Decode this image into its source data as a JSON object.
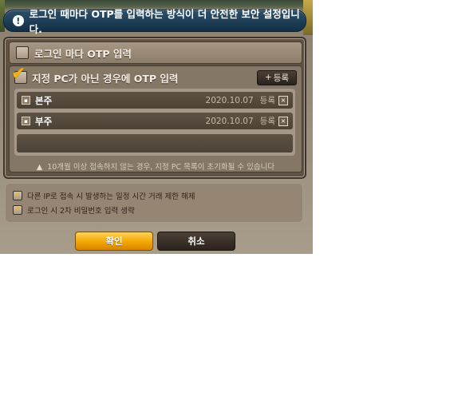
{
  "header": {
    "message": "로그인 때마다 OTP를 입력하는 방식이 더 안전한 보안 설정입니다.",
    "icon": "info-icon"
  },
  "options": {
    "every_login": {
      "label": "로그인 마다 OTP 입력",
      "checked": false
    },
    "non_designated": {
      "label": "지정 PC가 아닌 경우에 OTP 입력",
      "checked": true,
      "register_label": "등록"
    }
  },
  "pc_list": [
    {
      "name": "본주",
      "date": "2020.10.07",
      "status": "등록"
    },
    {
      "name": "부주",
      "date": "2020.10.07",
      "status": "등록"
    }
  ],
  "notice": "10개월 이상 접속하지 않는 경우, 지정 PC 목록이 초기화될 수 있습니다",
  "extra_options": [
    {
      "label": "다른 IP로 접속 시 발생하는 일정 시간 거래 제한 해제",
      "checked": true
    },
    {
      "label": "로그인 시 2차 비밀번호 입력 생략",
      "checked": true
    }
  ],
  "buttons": {
    "confirm": "확인",
    "cancel": "취소"
  },
  "colors": {
    "confirm": "#f3a600",
    "header": "#1d3d56",
    "check": "#ffb100"
  }
}
